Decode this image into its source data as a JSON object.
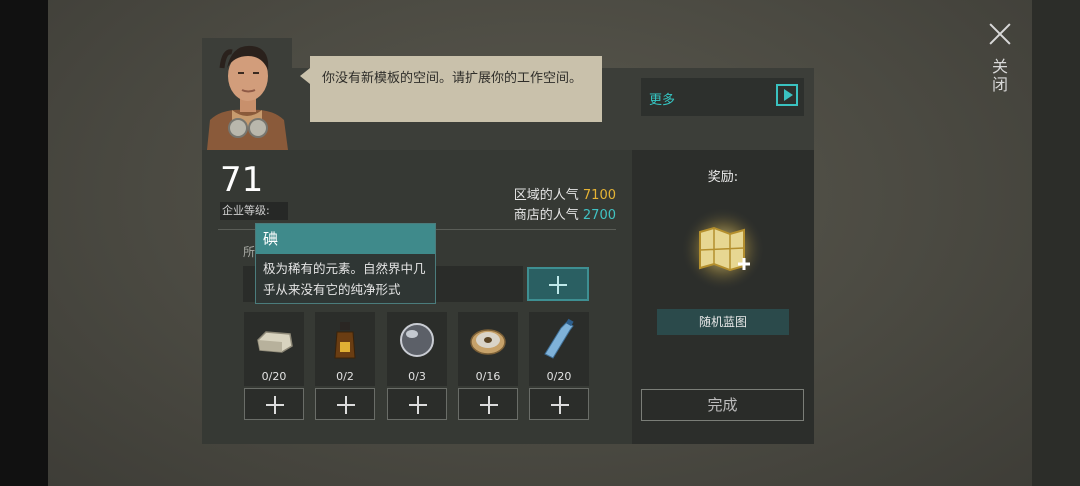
{
  "close": {
    "label": "关闭"
  },
  "dialog": {
    "speech": "你没有新模板的空间。请扩展你的工作空间。",
    "more_label": "更多"
  },
  "company": {
    "level_value": "71",
    "level_label": "企业等级:",
    "region_popularity_label": "区域的人气",
    "region_popularity_value": "7100",
    "shop_popularity_label": "商店的人气",
    "shop_popularity_value": "2700",
    "owned_label": "所"
  },
  "tooltip": {
    "title": "碘",
    "description": "极为稀有的元素。自然界中几乎从来没有它的纯净形式"
  },
  "materials": [
    {
      "icon": "stone-block-icon",
      "count": "0/20"
    },
    {
      "icon": "iodine-bottle-icon",
      "count": "0/2"
    },
    {
      "icon": "lens-icon",
      "count": "0/3"
    },
    {
      "icon": "wire-spool-icon",
      "count": "0/16"
    },
    {
      "icon": "plastic-bottle-icon",
      "count": "0/20"
    }
  ],
  "reward": {
    "title": "奖励:",
    "item_label": "随机蓝图",
    "icon": "blueprint-map-icon"
  },
  "complete_button": "完成",
  "colors": {
    "accent_cyan": "#40c2c4",
    "accent_yellow": "#e6b334",
    "tooltip_header": "#3f8a8b"
  }
}
